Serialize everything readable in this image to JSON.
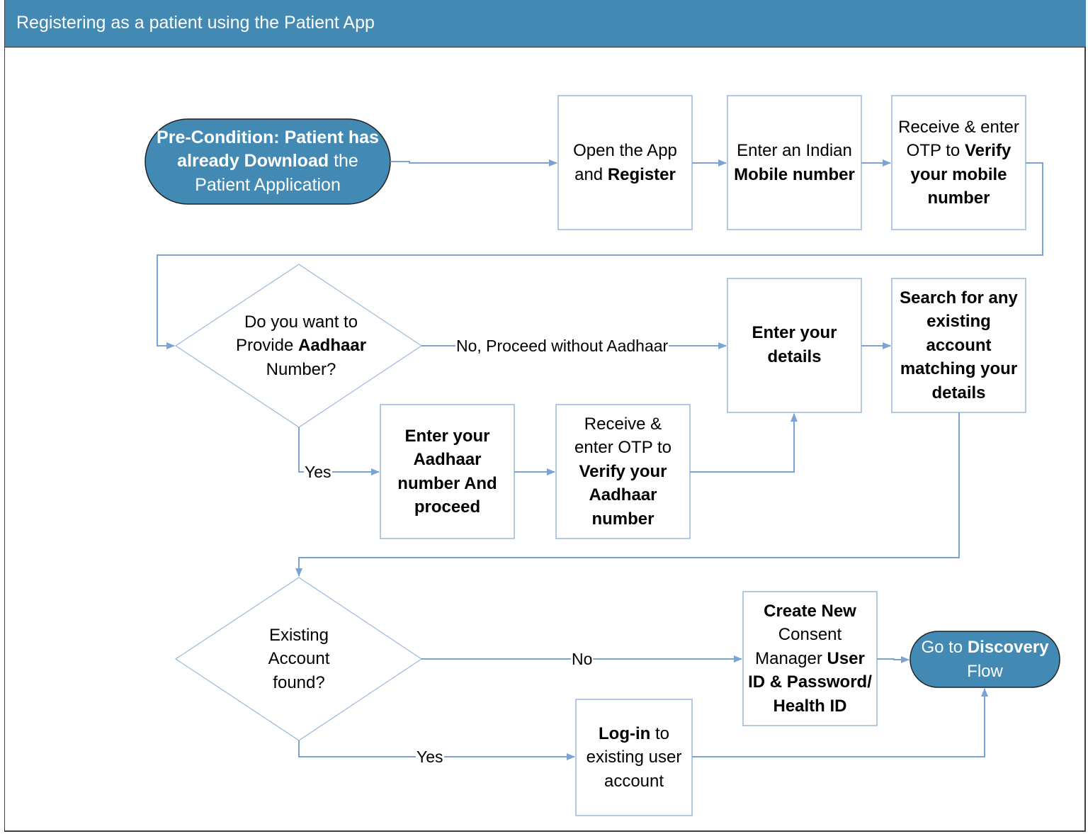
{
  "title": "Registering as a patient using the Patient App",
  "colors": {
    "header": "#428ab4",
    "terminal_fill": "#428ab4",
    "connector": "#7aa3d2",
    "box_border": "#9ab7da"
  },
  "nodes": {
    "precondition": {
      "type": "terminal",
      "segments": [
        {
          "text": "Pre-Condition: Patient has already Download",
          "bold": true
        },
        {
          "text": " the Patient Application",
          "bold": false
        }
      ]
    },
    "open_app": {
      "type": "process",
      "segments": [
        {
          "text": "Open the App and ",
          "bold": false
        },
        {
          "text": "Register",
          "bold": true
        }
      ]
    },
    "enter_mobile": {
      "type": "process",
      "segments": [
        {
          "text": "Enter an Indian ",
          "bold": false
        },
        {
          "text": "Mobile number",
          "bold": true
        }
      ]
    },
    "verify_mobile": {
      "type": "process",
      "segments": [
        {
          "text": "Receive & enter OTP to ",
          "bold": false
        },
        {
          "text": "Verify your mobile number",
          "bold": true
        }
      ]
    },
    "aadhaar_decision": {
      "type": "decision",
      "segments": [
        {
          "text": "Do you want to Provide ",
          "bold": false
        },
        {
          "text": "Aadhaar",
          "bold": true
        },
        {
          "text": " Number?",
          "bold": false
        }
      ]
    },
    "enter_details": {
      "type": "process",
      "segments": [
        {
          "text": "Enter your details",
          "bold": true
        }
      ]
    },
    "search_account": {
      "type": "process",
      "segments": [
        {
          "text": "Search for any existing account matching your details",
          "bold": true
        }
      ]
    },
    "enter_aadhaar": {
      "type": "process",
      "segments": [
        {
          "text": "Enter your Aadhaar number And proceed",
          "bold": true
        }
      ]
    },
    "verify_aadhaar": {
      "type": "process",
      "segments": [
        {
          "text": "Receive & enter OTP to ",
          "bold": false
        },
        {
          "text": "Verify your Aadhaar number",
          "bold": true
        }
      ]
    },
    "account_decision": {
      "type": "decision",
      "segments": [
        {
          "text": "Existing Account found?",
          "bold": false
        }
      ]
    },
    "create_account": {
      "type": "process",
      "segments": [
        {
          "text": "Create New",
          "bold": true
        },
        {
          "text": " Consent Manager ",
          "bold": false
        },
        {
          "text": "User ID & Password/ Health ID",
          "bold": true
        }
      ]
    },
    "discovery": {
      "type": "terminal",
      "segments": [
        {
          "text": "Go to ",
          "bold": false
        },
        {
          "text": "Discovery",
          "bold": true
        },
        {
          "text": " Flow",
          "bold": false
        }
      ]
    },
    "login": {
      "type": "process",
      "segments": [
        {
          "text": "Log-in",
          "bold": true
        },
        {
          "text": " to existing user account",
          "bold": false
        }
      ]
    }
  },
  "edges": [
    {
      "from": "precondition",
      "to": "open_app",
      "label": ""
    },
    {
      "from": "open_app",
      "to": "enter_mobile",
      "label": ""
    },
    {
      "from": "enter_mobile",
      "to": "verify_mobile",
      "label": ""
    },
    {
      "from": "verify_mobile",
      "to": "aadhaar_decision",
      "label": ""
    },
    {
      "from": "aadhaar_decision",
      "to": "enter_details",
      "label": "No, Proceed without Aadhaar"
    },
    {
      "from": "aadhaar_decision",
      "to": "enter_aadhaar",
      "label": "Yes"
    },
    {
      "from": "enter_aadhaar",
      "to": "verify_aadhaar",
      "label": ""
    },
    {
      "from": "verify_aadhaar",
      "to": "enter_details",
      "label": ""
    },
    {
      "from": "enter_details",
      "to": "search_account",
      "label": ""
    },
    {
      "from": "search_account",
      "to": "account_decision",
      "label": ""
    },
    {
      "from": "account_decision",
      "to": "create_account",
      "label": "No"
    },
    {
      "from": "account_decision",
      "to": "login",
      "label": "Yes"
    },
    {
      "from": "create_account",
      "to": "discovery",
      "label": ""
    },
    {
      "from": "login",
      "to": "discovery",
      "label": ""
    }
  ]
}
